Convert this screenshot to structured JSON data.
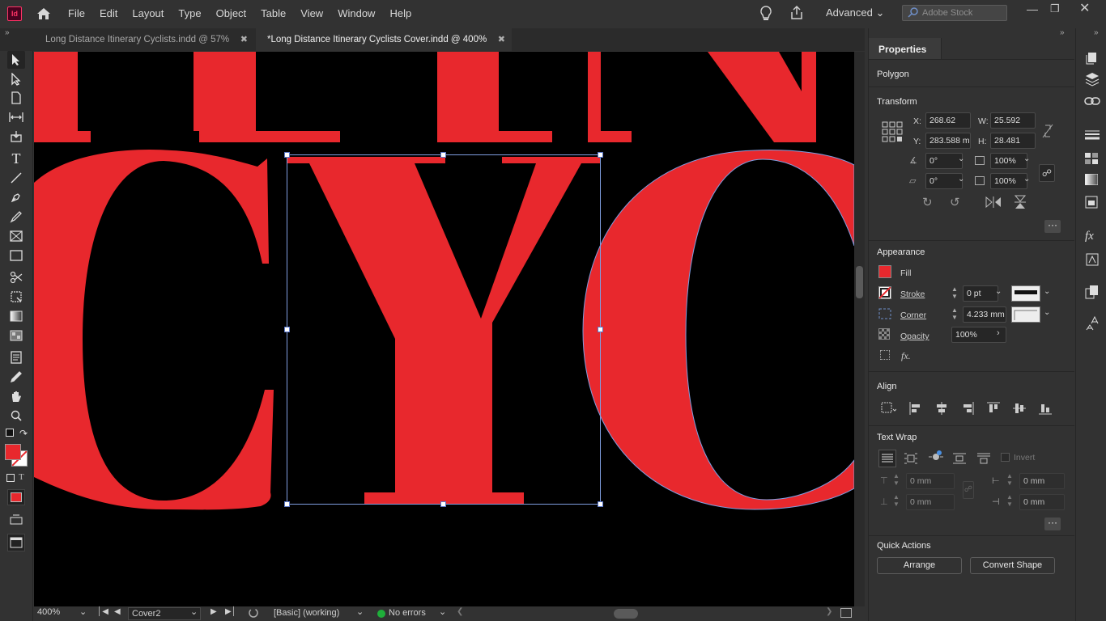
{
  "app": {
    "logo": "Id",
    "workspace": "Advanced",
    "search_placeholder": "Adobe Stock"
  },
  "menu": [
    "File",
    "Edit",
    "Layout",
    "Type",
    "Object",
    "Table",
    "View",
    "Window",
    "Help"
  ],
  "tabs": [
    {
      "label": "Long Distance Itinerary Cyclists.indd @ 57%",
      "active": false
    },
    {
      "label": "*Long Distance Itinerary Cyclists Cover.indd @ 400%",
      "active": true
    }
  ],
  "canvas": {
    "letters_top": "ITIN",
    "letters_main": "CYC",
    "text_color": "#e8282d"
  },
  "status": {
    "zoom": "400%",
    "page": "Cover2",
    "style": "[Basic] (working)",
    "preflight": "No errors"
  },
  "properties": {
    "panel_title": "Properties",
    "object_type": "Polygon",
    "transform": {
      "title": "Transform",
      "x_label": "X:",
      "x": "268.62 mm",
      "y_label": "Y:",
      "y": "283.588 mm",
      "w_label": "W:",
      "w": "25.592 mm",
      "h_label": "H:",
      "h": "28.481 mm",
      "rotate": "0°",
      "shear": "0°",
      "scale_x": "100%",
      "scale_y": "100%"
    },
    "appearance": {
      "title": "Appearance",
      "fill_label": "Fill",
      "fill_color": "#e8282d",
      "stroke_label": "Stroke",
      "stroke_value": "0 pt",
      "corner_label": "Corner",
      "corner_value": "4.233 mm",
      "opacity_label": "Opacity",
      "opacity_value": "100%",
      "fx_label": "fx."
    },
    "align": {
      "title": "Align"
    },
    "text_wrap": {
      "title": "Text Wrap",
      "invert_label": "Invert",
      "top": "0 mm",
      "bottom": "0 mm",
      "left": "0 mm",
      "right": "0 mm"
    },
    "quick_actions": {
      "title": "Quick Actions",
      "arrange": "Arrange",
      "convert_shape": "Convert Shape"
    }
  }
}
